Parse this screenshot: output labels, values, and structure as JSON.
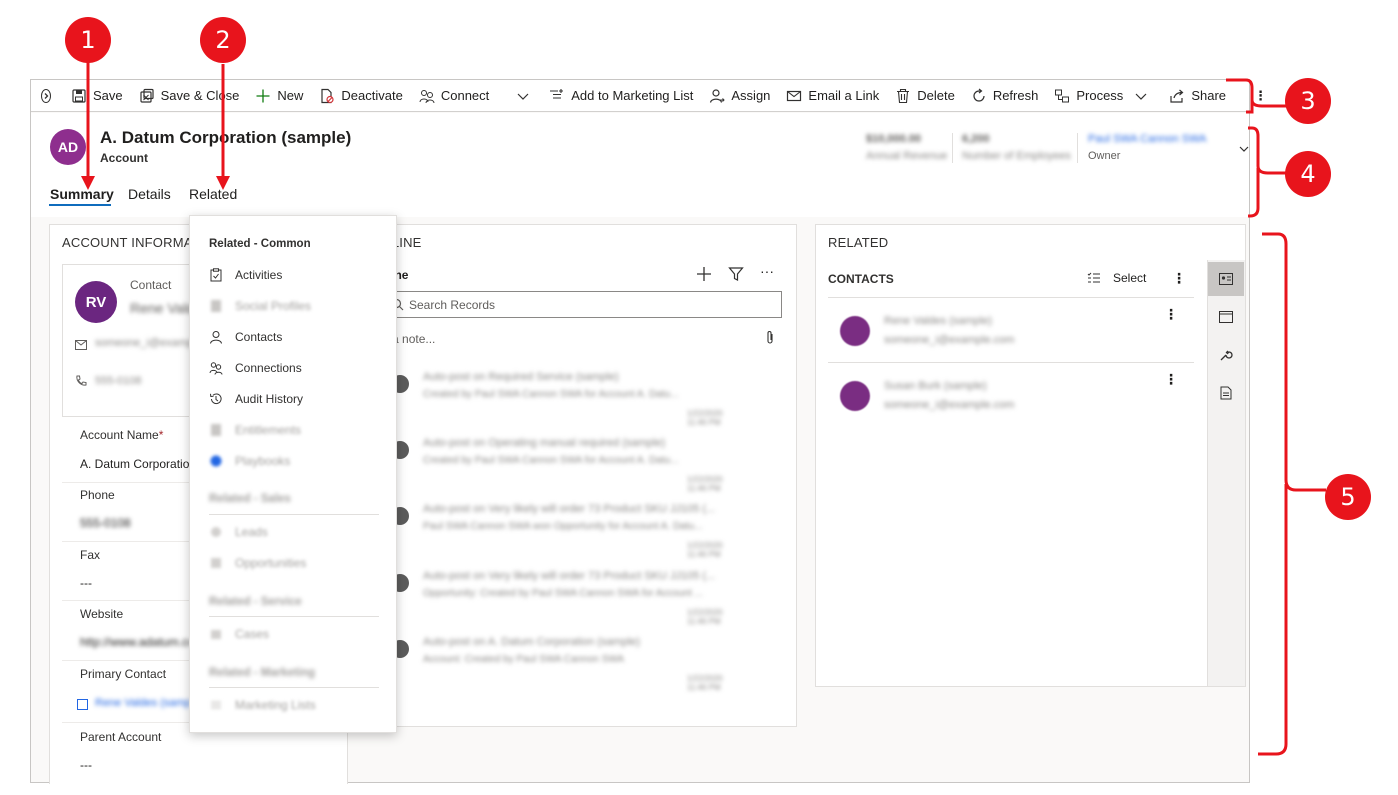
{
  "commandbar": {
    "items": [
      {
        "label": "Save",
        "icon": "save-icon"
      },
      {
        "label": "Save & Close",
        "icon": "save-close-icon"
      },
      {
        "label": "New",
        "icon": "plus-icon"
      },
      {
        "label": "Deactivate",
        "icon": "deactivate-icon"
      },
      {
        "label": "Connect",
        "icon": "connect-icon"
      },
      {
        "label": "Add to Marketing List",
        "icon": "list-add-icon"
      },
      {
        "label": "Assign",
        "icon": "assign-icon"
      },
      {
        "label": "Email a Link",
        "icon": "email-icon"
      },
      {
        "label": "Delete",
        "icon": "trash-icon"
      },
      {
        "label": "Refresh",
        "icon": "refresh-icon"
      },
      {
        "label": "Process",
        "icon": "process-icon"
      },
      {
        "label": "Share",
        "icon": "share-icon"
      }
    ],
    "more": "⋮"
  },
  "header": {
    "avatar_initials": "AD",
    "avatar_color": "#8e2e8e",
    "title": "A. Datum Corporation (sample)",
    "entity": "Account",
    "fields": [
      {
        "value": "$10,000.00",
        "label": "Annual Revenue"
      },
      {
        "value": "6,200",
        "label": "Number of Employees"
      },
      {
        "value": "Paul SWA Cannon SWA",
        "label": "Owner"
      }
    ]
  },
  "tabs": [
    "Summary",
    "Details",
    "Related"
  ],
  "account_info": {
    "title": "ACCOUNT INFORMATION",
    "contact_card": {
      "initials": "RV",
      "caption": "Contact",
      "name": "Rene Valdes",
      "email": "someone_i@example.com",
      "phone": "555-0108"
    },
    "fields": [
      {
        "label": "Account Name",
        "required": "*",
        "value": "A. Datum Corporation (sample)"
      },
      {
        "label": "Phone",
        "value": "555-0108"
      },
      {
        "label": "Fax",
        "value": "---"
      },
      {
        "label": "Website",
        "value": "http://www.adatum.com"
      },
      {
        "label": "Primary Contact",
        "value": "Rene Valdes (sample)"
      },
      {
        "label": "Parent Account",
        "value": "---"
      }
    ]
  },
  "related_menu": {
    "sections": [
      {
        "title": "Related - Common",
        "items": [
          "Activities",
          "Social Profiles",
          "Contacts",
          "Connections",
          "Audit History",
          "Entitlements",
          "Playbooks"
        ]
      },
      {
        "title": "Related - Sales",
        "items": [
          "Leads",
          "Opportunities"
        ]
      },
      {
        "title": "Related - Service",
        "items": [
          "Cases"
        ]
      },
      {
        "title": "Related - Marketing",
        "items": [
          "Marketing Lists"
        ]
      }
    ]
  },
  "timeline": {
    "title": "TIMELINE",
    "subtitle": "Timeline",
    "search_placeholder": "Search Records",
    "note_placeholder": "Enter a note...",
    "entries": [
      {
        "title": "Auto-post on Required Service (sample)",
        "sub": "Created by Paul SWA Cannon SWA for Account A. Datu...",
        "time": "1/22/2020 11:46 PM"
      },
      {
        "title": "Auto-post on Operating manual required (sample)",
        "sub": "Created by Paul SWA Cannon SWA for Account A. Datu...",
        "time": "1/22/2020 11:46 PM"
      },
      {
        "title": "Auto-post on Very likely will order 73 Product SKU JJ105 (...",
        "sub": "Paul SWA Cannon SWA won Opportunity for Account A. Datu...",
        "time": "1/22/2020 11:46 PM"
      },
      {
        "title": "Auto-post on Very likely will order 73 Product SKU JJ105 (...",
        "sub": "Opportunity: Created by Paul SWA Cannon SWA for Account ...",
        "time": "1/22/2020 11:46 PM"
      },
      {
        "title": "Auto-post on A. Datum Corporation (sample)",
        "sub": "Account: Created by Paul SWA Cannon SWA",
        "time": "1/22/2020 11:46 PM"
      }
    ]
  },
  "related": {
    "title": "RELATED",
    "contacts_title": "CONTACTS",
    "select_label": "Select",
    "contacts": [
      {
        "name": "Rene Valdes (sample)",
        "email": "someone_i@example.com"
      },
      {
        "name": "Susan Burk (sample)",
        "email": "someone_i@example.com"
      }
    ]
  },
  "callouts": [
    "1",
    "2",
    "3",
    "4",
    "5"
  ]
}
